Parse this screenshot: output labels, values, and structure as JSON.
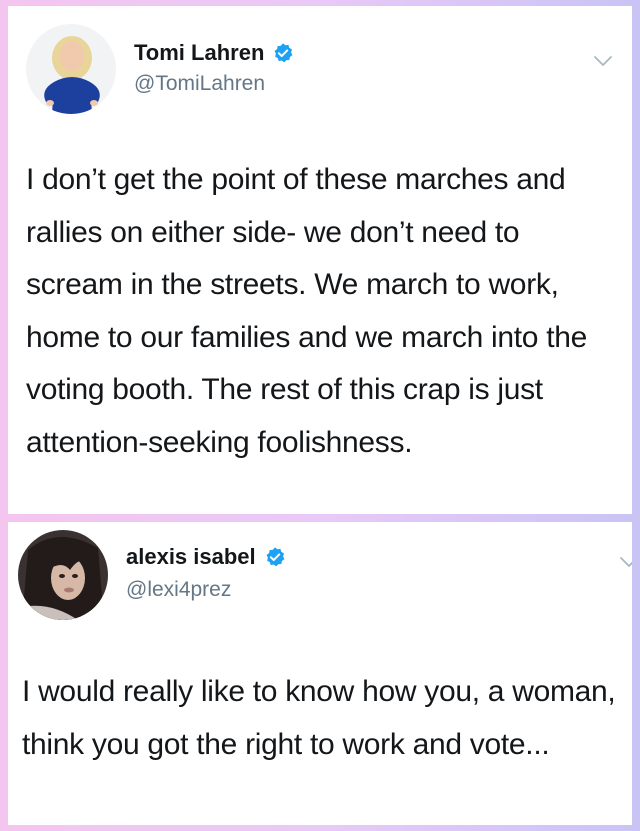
{
  "tweets": [
    {
      "display_name": "Tomi Lahren",
      "handle": "@TomiLahren",
      "verified": true,
      "avatar": "profile-photo-blonde-woman-blue-dress",
      "text": "I don’t get the point of these marches and rallies on either side- we don’t need to scream in the streets. We march to work, home to our families and we march into the voting booth. The rest of this crap is just attention-seeking foolishness."
    },
    {
      "display_name": "alexis isabel",
      "handle": "@lexi4prez",
      "verified": true,
      "avatar": "profile-photo-dark-haired-woman",
      "text": "I would really like to know how you, a woman, think you got the right to work and vote..."
    }
  ],
  "icons": {
    "verified": "verified-badge-icon",
    "menu": "chevron-down-icon"
  },
  "colors": {
    "verified_blue": "#1da1f2",
    "handle_gray": "#657786",
    "text": "#14171a",
    "background_left": "#f4c6ef",
    "background_right": "#c9c4f5"
  }
}
